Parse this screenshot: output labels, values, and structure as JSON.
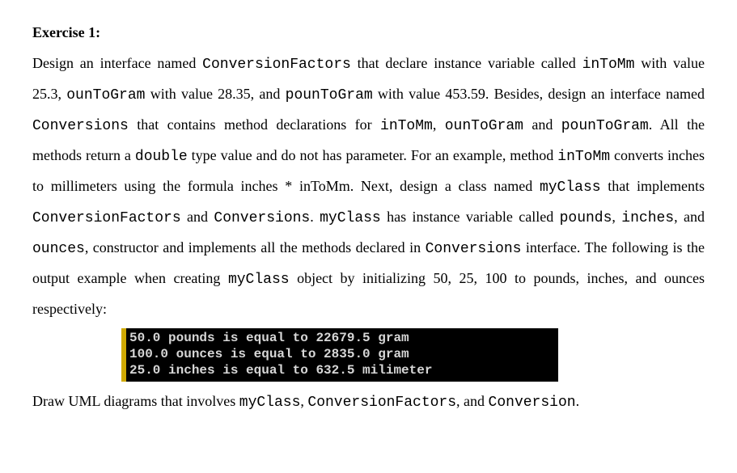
{
  "heading": "Exercise 1:",
  "para1_parts": {
    "t1": "Design an interface named ",
    "c1": "ConversionFactors",
    "t2": " that declare instance variable called ",
    "c2": "inToMm",
    "t3": " with value 25.3, ",
    "c3": "ounToGram",
    "t4": " with value 28.35, and ",
    "c4": "pounToGram",
    "t5": " with value 453.59. Besides, design an interface named ",
    "c5": "Conversions",
    "t6": " that contains method declarations for ",
    "c6": "inToMm",
    "t7": ", ",
    "c7": "ounToGram",
    "t8": " and ",
    "c8": "pounToGram",
    "t9": ". All the methods return a ",
    "c9": "double",
    "t10": " type value and do not has parameter.  For an example, method ",
    "c10": "inToMm",
    "t11": "  converts inches to millimeters using the formula inches  *  inToMm.  Next,  design  a  class  named  ",
    "c11": "myClass",
    "t12": "  that  implements ",
    "c12": "ConversionFactors",
    "t13": " and ",
    "c13": "Conversions",
    "t14": ". ",
    "c14": "myClass",
    "t15": " has instance variable called ",
    "c15": "pounds",
    "t16": ", ",
    "c16": "inches",
    "t17": ", and ",
    "c17": "ounces",
    "t18": ", constructor and implements all the methods declared in ",
    "c18": "Conversions",
    "t19": " interface. The following is the output example when creating ",
    "c19": "myClass",
    "t20": "  object by initializing 50, 25, 100 to pounds, inches, and ounces respectively:"
  },
  "console": {
    "line1": "50.0 pounds is equal to 22679.5 gram",
    "line2": "100.0 ounces is equal to 2835.0 gram",
    "line3": "25.0 inches is equal to 632.5 milimeter"
  },
  "para2_parts": {
    "t1": "Draw UML diagrams that involves ",
    "c1": "myClass",
    "t2": ", ",
    "c2": "ConversionFactors",
    "t3": ", and ",
    "c3": "Conversion",
    "t4": "."
  }
}
